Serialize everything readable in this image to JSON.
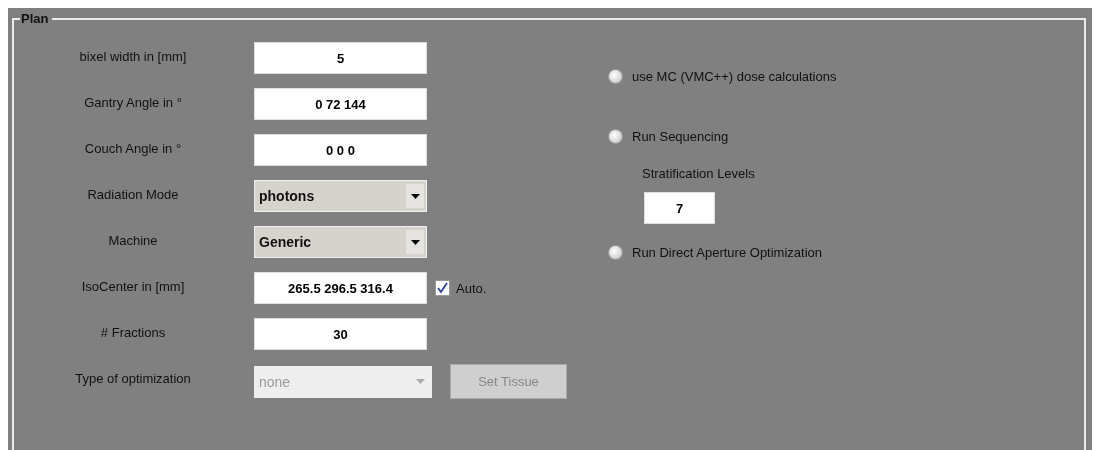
{
  "panel": {
    "title": "Plan"
  },
  "rows": [
    {
      "label": "bixel width in [mm]",
      "kind": "field",
      "value": "5"
    },
    {
      "label": "Gantry Angle in °",
      "kind": "field",
      "value": "0 72 144"
    },
    {
      "label": "Couch Angle in °",
      "kind": "field",
      "value": "0 0 0"
    },
    {
      "label": "Radiation Mode",
      "kind": "dropdown",
      "value": "photons",
      "disabled": false
    },
    {
      "label": "Machine",
      "kind": "dropdown",
      "value": "Generic",
      "disabled": false
    },
    {
      "label": "IsoCenter in [mm]",
      "kind": "field",
      "value": "265.5 296.5 316.4",
      "checkbox": {
        "label": "Auto.",
        "checked": true
      }
    },
    {
      "label": "# Fractions",
      "kind": "field",
      "value": "30"
    },
    {
      "label": "Type of optimization",
      "kind": "dropdown",
      "value": "none",
      "disabled": true,
      "button": {
        "label": "Set Tissue",
        "disabled": true
      }
    }
  ],
  "options": [
    {
      "kind": "radio",
      "label": "use MC (VMC++) dose calculations",
      "selected": false
    },
    {
      "kind": "radio",
      "label": "Run Sequencing",
      "selected": false
    },
    {
      "kind": "field",
      "label": "Stratification Levels",
      "value": "7"
    },
    {
      "kind": "radio",
      "label": "Run Direct Aperture Optimization",
      "selected": false
    }
  ]
}
